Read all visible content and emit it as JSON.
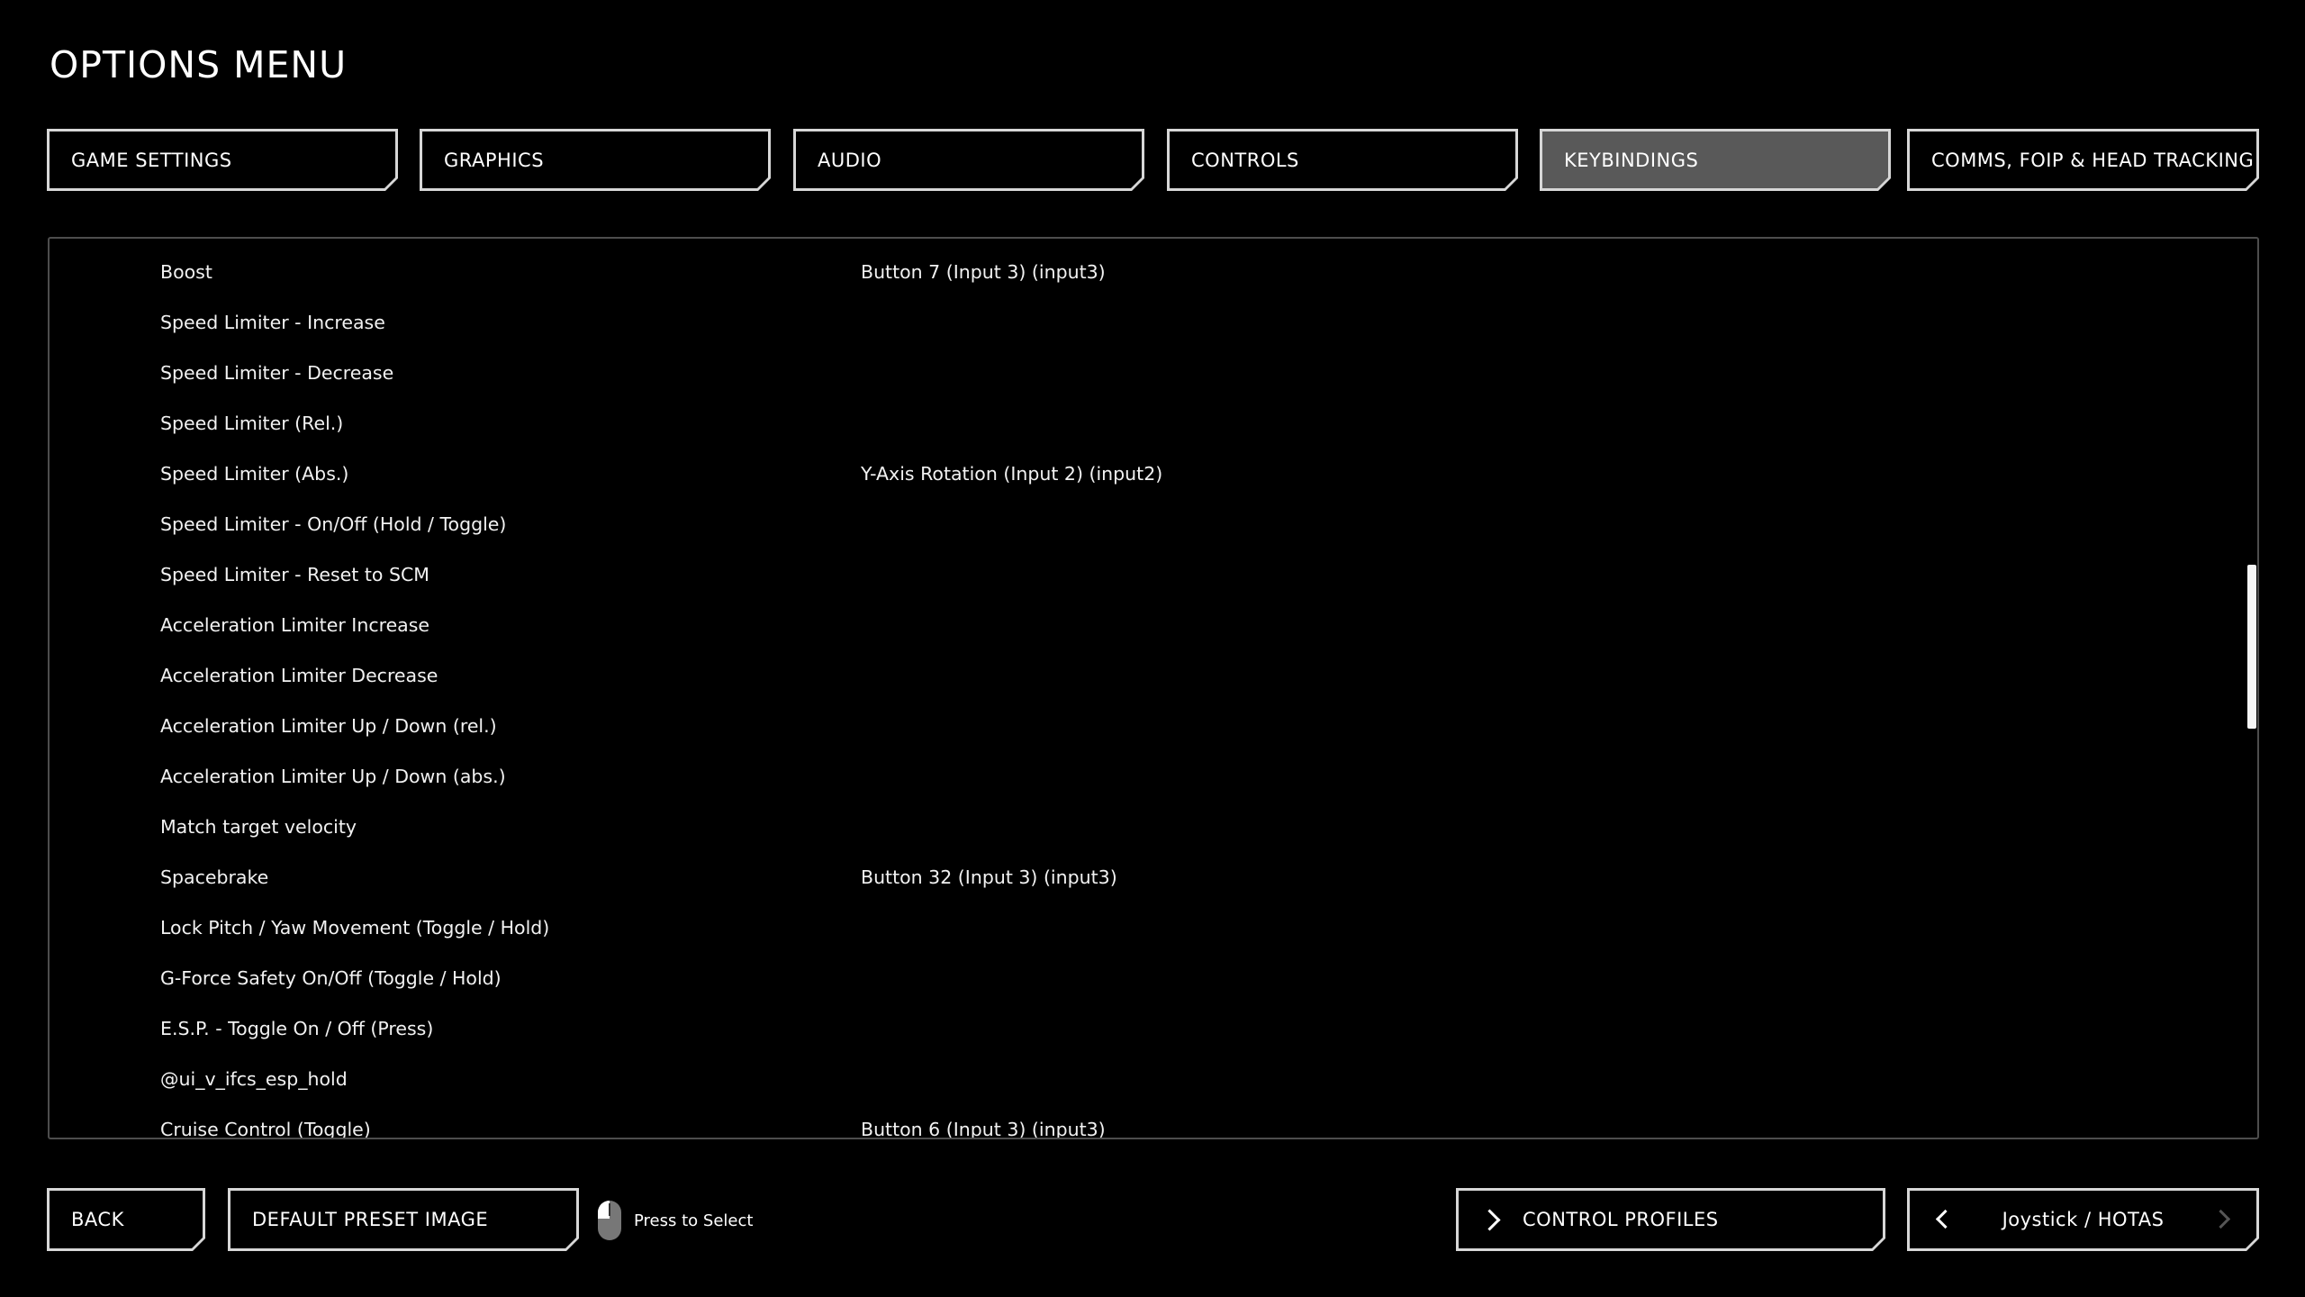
{
  "header": {
    "title": "OPTIONS MENU"
  },
  "tabs": [
    {
      "label": "GAME SETTINGS",
      "active": false
    },
    {
      "label": "GRAPHICS",
      "active": false
    },
    {
      "label": "AUDIO",
      "active": false
    },
    {
      "label": "CONTROLS",
      "active": false
    },
    {
      "label": "KEYBINDINGS",
      "active": true
    },
    {
      "label": "COMMS, FOIP & HEAD TRACKING",
      "active": false
    }
  ],
  "bindings": [
    {
      "action": "Boost",
      "binding": "Button 7 (Input 3) (input3)"
    },
    {
      "action": "Speed Limiter - Increase",
      "binding": ""
    },
    {
      "action": "Speed Limiter - Decrease",
      "binding": ""
    },
    {
      "action": "Speed Limiter (Rel.)",
      "binding": ""
    },
    {
      "action": "Speed Limiter (Abs.)",
      "binding": "Y-Axis Rotation (Input 2) (input2)"
    },
    {
      "action": "Speed Limiter - On/Off (Hold / Toggle)",
      "binding": ""
    },
    {
      "action": "Speed Limiter - Reset to SCM",
      "binding": ""
    },
    {
      "action": "Acceleration Limiter Increase",
      "binding": ""
    },
    {
      "action": "Acceleration Limiter Decrease",
      "binding": ""
    },
    {
      "action": "Acceleration Limiter Up / Down (rel.)",
      "binding": ""
    },
    {
      "action": "Acceleration Limiter Up / Down (abs.)",
      "binding": ""
    },
    {
      "action": "Match target velocity",
      "binding": ""
    },
    {
      "action": "Spacebrake",
      "binding": "Button 32 (Input 3) (input3)"
    },
    {
      "action": "Lock Pitch / Yaw Movement (Toggle / Hold)",
      "binding": ""
    },
    {
      "action": "G-Force Safety On/Off (Toggle / Hold)",
      "binding": ""
    },
    {
      "action": "E.S.P. - Toggle On / Off (Press)",
      "binding": ""
    },
    {
      "action": "@ui_v_ifcs_esp_hold",
      "binding": ""
    },
    {
      "action": "Cruise Control (Toggle)",
      "binding": "Button 6 (Input 3) (input3)"
    }
  ],
  "footer": {
    "back_label": "BACK",
    "default_preset_label": "DEFAULT PRESET IMAGE",
    "hint_label": "Press to Select",
    "control_profiles_label": "CONTROL PROFILES",
    "device_label": "Joystick / HOTAS"
  }
}
